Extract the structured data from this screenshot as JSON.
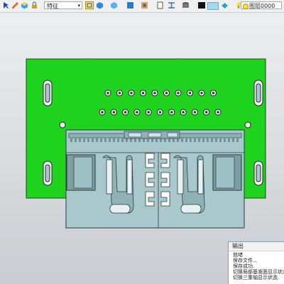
{
  "toolbar": {
    "feature_select": "特征",
    "color_swatch_dark": "#111111",
    "color_swatch_light": "#9fd9f2",
    "layer_select": "图层0000"
  },
  "colors": {
    "board_green": "#1ed21e",
    "housing_blue": "#a9c8cc",
    "outline": "#2b3b3d"
  },
  "output_panel": {
    "title": "输出",
    "lines": [
      "就绪",
      "保存文件...",
      "保存成功.",
      "切换局部基准面显示状态",
      "切换三重轴显示状态."
    ]
  }
}
